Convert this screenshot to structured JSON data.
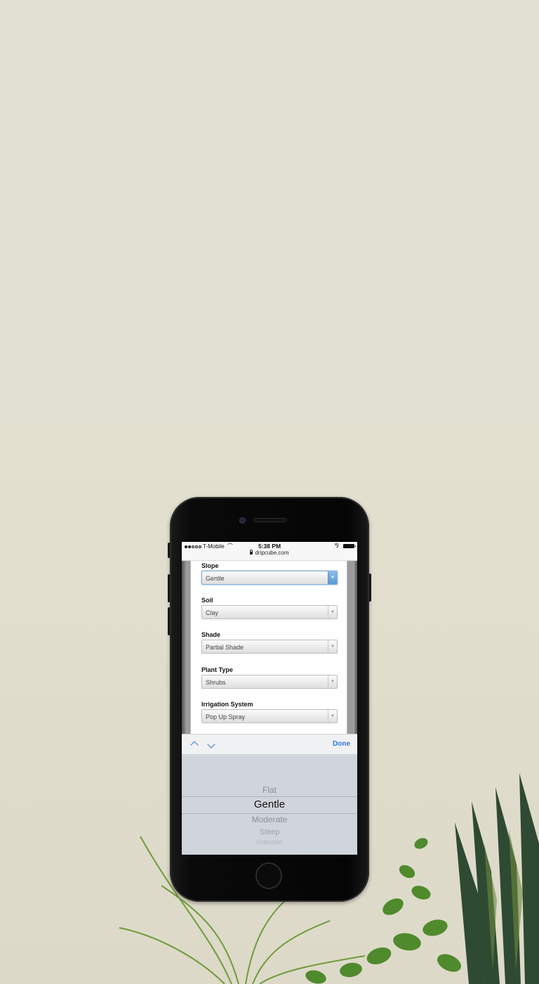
{
  "status_bar": {
    "carrier": "T-Mobile",
    "time": "5:38 PM"
  },
  "browser": {
    "url": "dripcube.com"
  },
  "form": {
    "fields": [
      {
        "label": "Slope",
        "value": "Gentle",
        "active": true
      },
      {
        "label": "Soil",
        "value": "Clay",
        "active": false
      },
      {
        "label": "Shade",
        "value": "Partial Shade",
        "active": false
      },
      {
        "label": "Plant Type",
        "value": "Shrubs",
        "active": false
      },
      {
        "label": "Irrigation System",
        "value": "Pop Up Spray",
        "active": false
      }
    ]
  },
  "toolbar": {
    "done_label": "Done"
  },
  "picker": {
    "options": [
      "Flat",
      "Gentle",
      "Moderate",
      "Steep",
      "Unknown"
    ],
    "selected": "Gentle"
  },
  "colors": {
    "accent": "#2f7ad8",
    "background": "#e2e0d0",
    "picker_bg": "#d0d4db"
  }
}
